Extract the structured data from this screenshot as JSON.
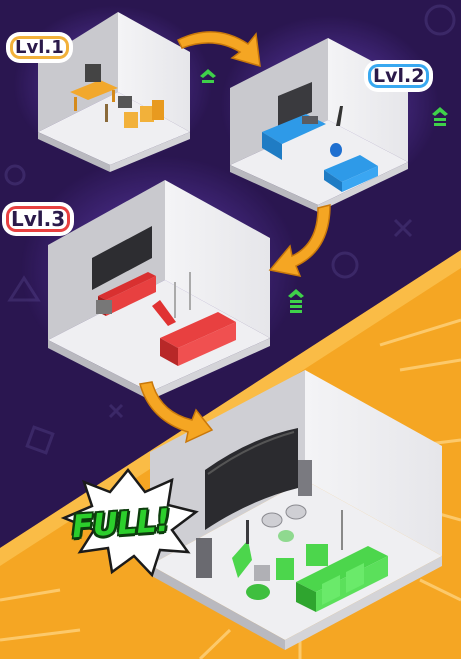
{
  "levels": [
    {
      "label": "Lvl.1",
      "accent": "#f2b13a"
    },
    {
      "label": "Lvl.2",
      "accent": "#38a8f0"
    },
    {
      "label": "Lvl.3",
      "accent": "#e84040"
    }
  ],
  "final": {
    "badge": "FULL!",
    "accent": "#2ccf2c"
  },
  "colors": {
    "background_top": "#2a1650",
    "background_bottom": "#f5a623",
    "arrow": "#f5a623",
    "upgrade_icon": "#3fd14a"
  },
  "icons": [
    "upgrade-arrow-icon",
    "curved-arrow-icon",
    "starburst-badge-icon"
  ]
}
